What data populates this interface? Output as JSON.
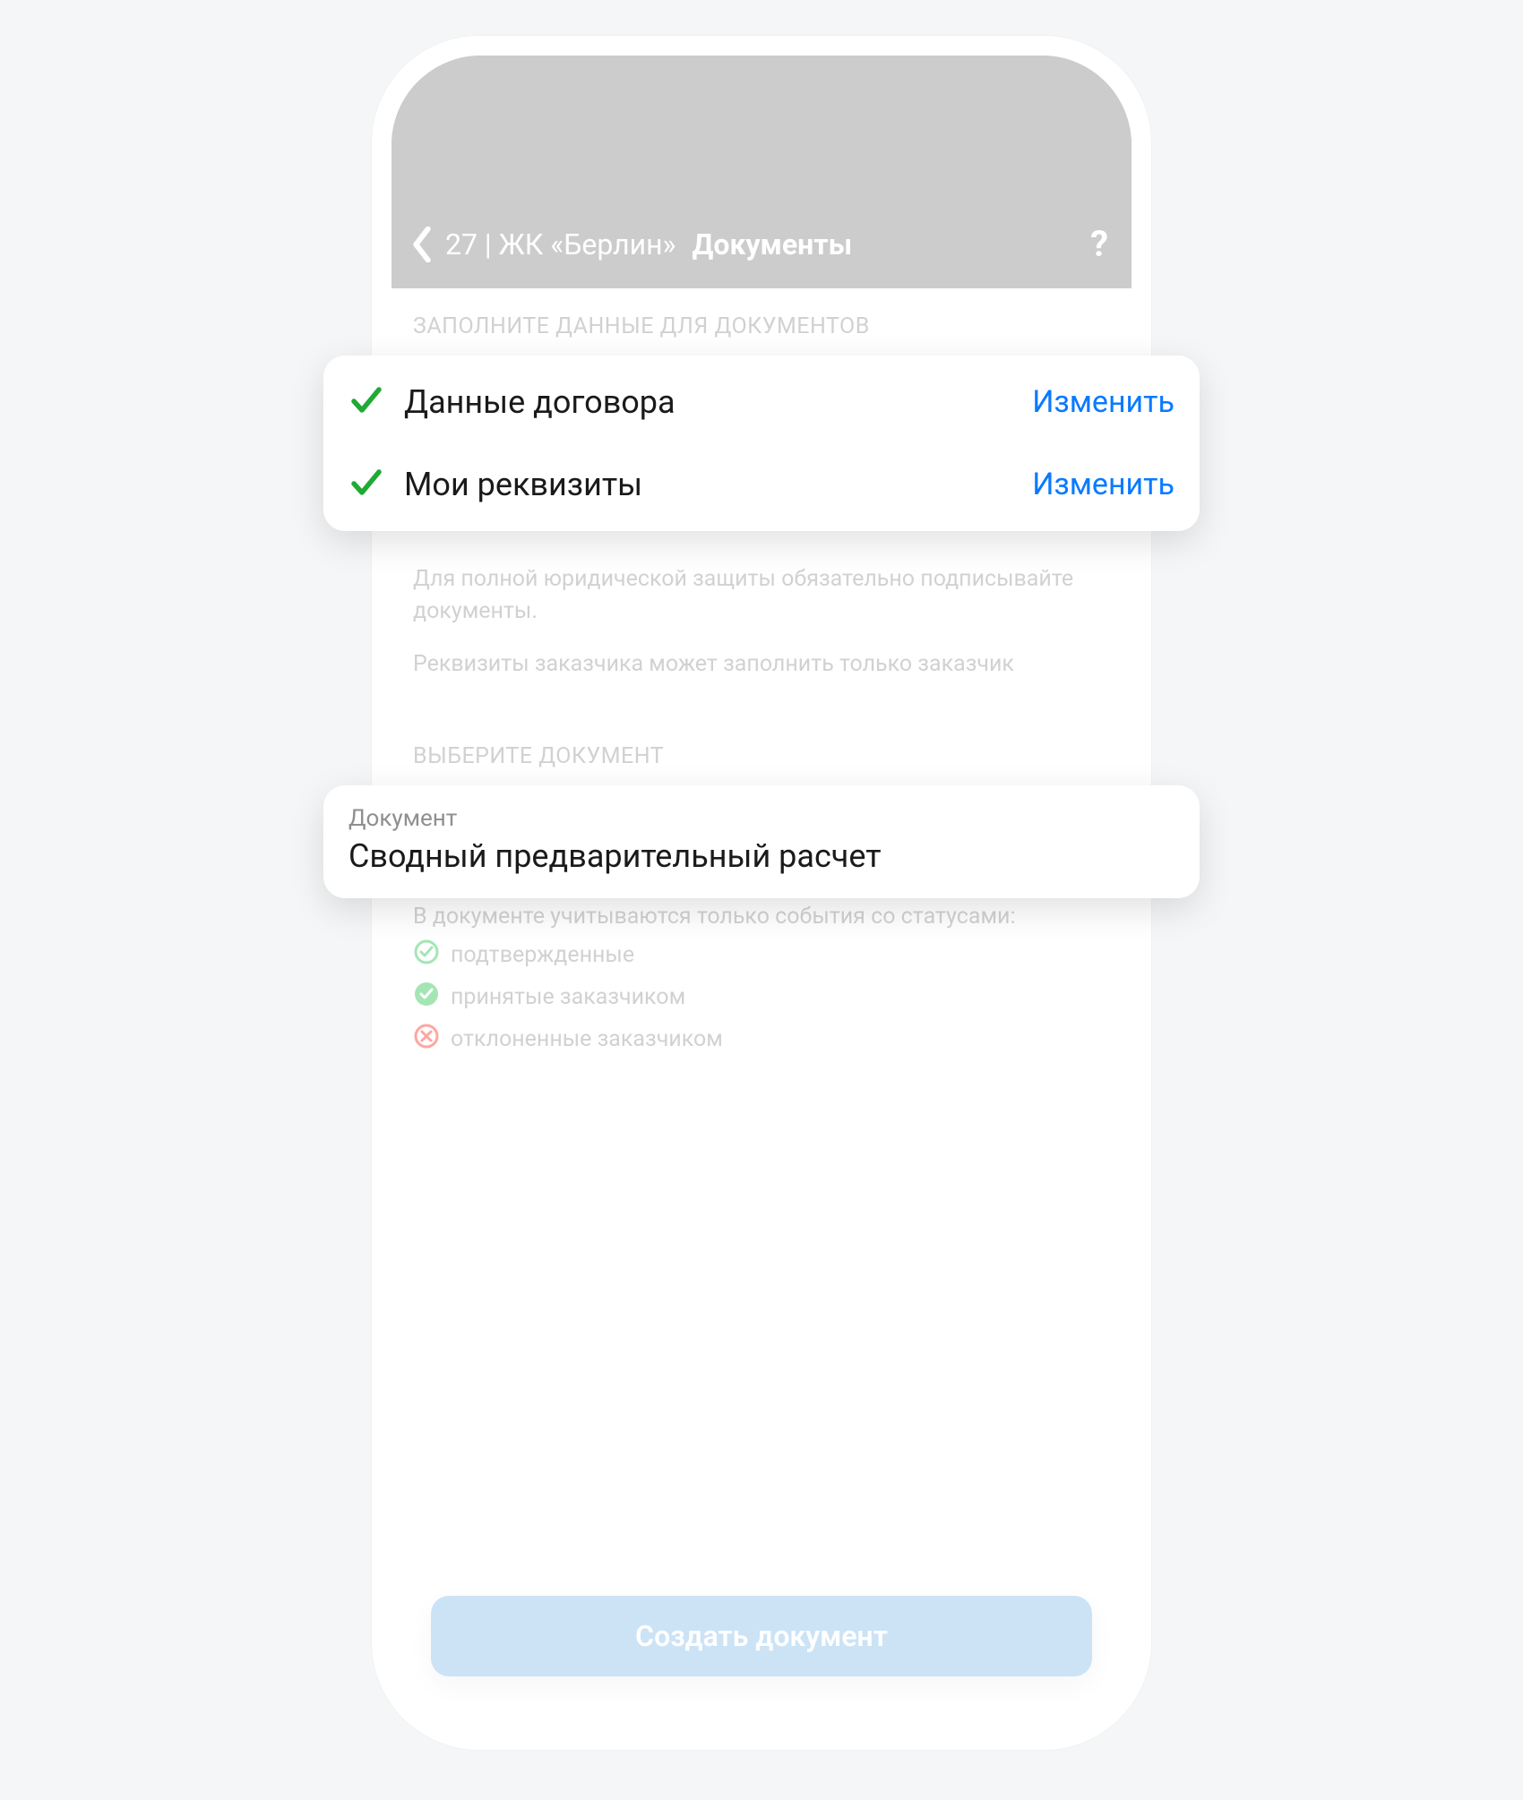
{
  "header": {
    "breadcrumb": "27 | ЖК «Берлин»",
    "title": "Документы",
    "help_symbol": "?"
  },
  "section_fill": {
    "label": "ЗАПОЛНИТЕ ДАННЫЕ ДЛЯ ДОКУМЕНТОВ",
    "rows": [
      {
        "label": "Данные договора",
        "action": "Изменить"
      },
      {
        "label": "Мои реквизиты",
        "action": "Изменить"
      }
    ],
    "note1": "Для полной юридической защиты обязательно подписывайте документы.",
    "note2": "Реквизиты заказчика может заполнить только заказчик"
  },
  "section_doc": {
    "label": "ВЫБЕРИТЕ ДОКУМЕНТ",
    "field_label": "Документ",
    "field_value": "Сводный предварительный расчет",
    "status_intro": "В документе учитываются только события со статусами:",
    "statuses": [
      {
        "label": "подтвержденные",
        "color": "#34c759",
        "kind": "check"
      },
      {
        "label": "принятые заказчиком",
        "color": "#34c759",
        "kind": "check"
      },
      {
        "label": "отклоненные заказчиком",
        "color": "#ff3b30",
        "kind": "cross"
      }
    ]
  },
  "primary_button_label": "Создать документ",
  "colors": {
    "accent_blue": "#0a7aff",
    "button_blue": "#8fc0ec",
    "check_green": "#1faa34",
    "header_gray": "#8f8f8f"
  }
}
